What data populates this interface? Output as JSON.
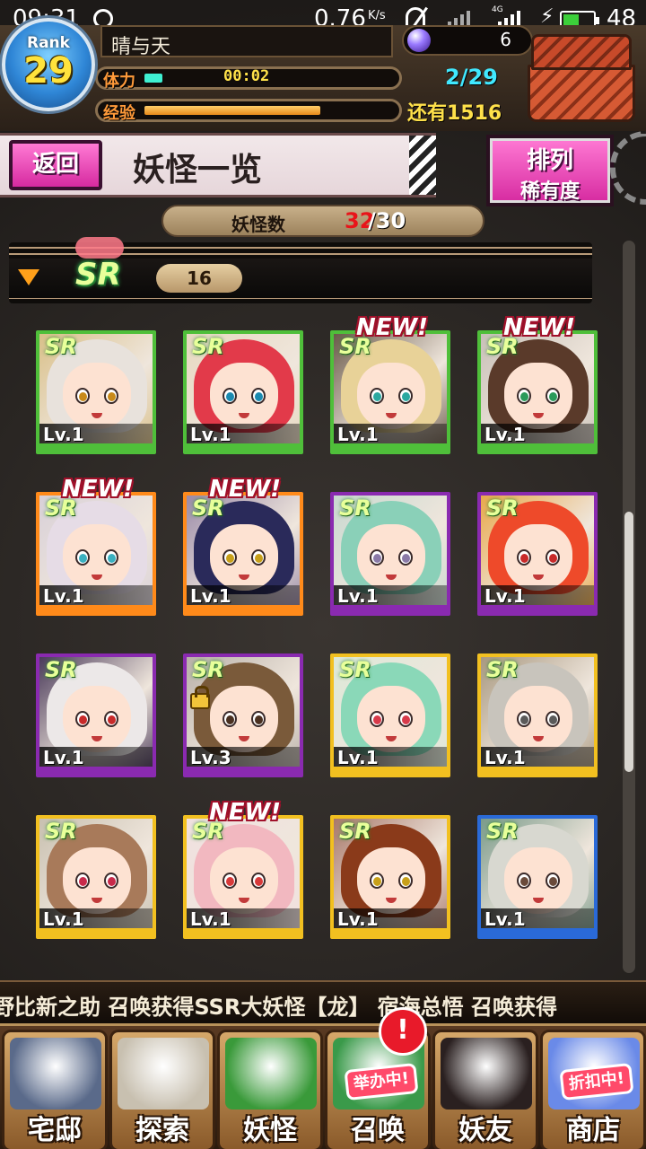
{
  "status_bar": {
    "time": "09:31",
    "net_speed": "0.76",
    "net_unit": "K/s",
    "network": "4G",
    "battery": "48"
  },
  "player": {
    "rank_label": "Rank",
    "rank": "29",
    "name": "晴与天",
    "stamina_label": "体力",
    "stamina_timer": "00:02",
    "stamina_value": "2/29",
    "stamina_fraction": 0.07,
    "exp_label": "经验",
    "exp_remaining": "还有1516",
    "exp_fraction": 0.7,
    "currency": "6"
  },
  "titlebar": {
    "back_label": "返回",
    "title": "妖怪一览",
    "sort_line1": "排列",
    "sort_line2": "稀有度"
  },
  "count": {
    "label": "妖怪数",
    "current": "32",
    "max": "/30"
  },
  "section": {
    "rarity": "SR",
    "count": "16"
  },
  "cards": [
    {
      "rarity": "SR",
      "level": "Lv.1",
      "is_new": false,
      "locked": false,
      "frame": "#4fbf3a",
      "hair": "#e8e2dc",
      "eye": "#c88a1a",
      "bg": "#d9c089"
    },
    {
      "rarity": "SR",
      "level": "Lv.1",
      "is_new": false,
      "locked": false,
      "frame": "#4fbf3a",
      "hair": "#e23a4a",
      "eye": "#1a8ab0",
      "bg": "#e7d8c0"
    },
    {
      "rarity": "SR",
      "level": "Lv.1",
      "is_new": true,
      "locked": false,
      "frame": "#4fbf3a",
      "hair": "#e8d298",
      "eye": "#2aa8a0",
      "bg": "#6a5a4a"
    },
    {
      "rarity": "SR",
      "level": "Lv.1",
      "is_new": true,
      "locked": false,
      "frame": "#4fbf3a",
      "hair": "#5a3a2a",
      "eye": "#2a9a5a",
      "bg": "#c8c0b8"
    },
    {
      "rarity": "SR",
      "level": "Lv.1",
      "is_new": true,
      "locked": false,
      "frame": "#ff8a1a",
      "hair": "#e6dce6",
      "eye": "#3ab0c0",
      "bg": "#d8d0d8"
    },
    {
      "rarity": "SR",
      "level": "Lv.1",
      "is_new": true,
      "locked": false,
      "frame": "#ff8a1a",
      "hair": "#2a2a5a",
      "eye": "#c8a01a",
      "bg": "#9a8aa8"
    },
    {
      "rarity": "SR",
      "level": "Lv.1",
      "is_new": false,
      "locked": false,
      "frame": "#8a2ab0",
      "hair": "#8ad0b8",
      "eye": "#8a7aa8",
      "bg": "#c8d8d0"
    },
    {
      "rarity": "SR",
      "level": "Lv.1",
      "is_new": false,
      "locked": false,
      "frame": "#8a2ab0",
      "hair": "#ee4a2a",
      "eye": "#c82a2a",
      "bg": "#e8a84a"
    },
    {
      "rarity": "SR",
      "level": "Lv.1",
      "is_new": false,
      "locked": false,
      "frame": "#8a2ab0",
      "hair": "#ece8e8",
      "eye": "#c82a2a",
      "bg": "#4a3a5a"
    },
    {
      "rarity": "SR",
      "level": "Lv.3",
      "is_new": false,
      "locked": true,
      "frame": "#8a2ab0",
      "hair": "#7a5a3a",
      "eye": "#4a3020",
      "bg": "#b8b0a8"
    },
    {
      "rarity": "SR",
      "level": "Lv.1",
      "is_new": false,
      "locked": false,
      "frame": "#f2c020",
      "hair": "#8ad8b8",
      "eye": "#d83a4a",
      "bg": "#dce8d8"
    },
    {
      "rarity": "SR",
      "level": "Lv.1",
      "is_new": false,
      "locked": false,
      "frame": "#f2c020",
      "hair": "#c8c4bc",
      "eye": "#5a5a5a",
      "bg": "#a89880"
    },
    {
      "rarity": "SR",
      "level": "Lv.1",
      "is_new": false,
      "locked": false,
      "frame": "#f2c020",
      "hair": "#a87a5a",
      "eye": "#c82a4a",
      "bg": "#c8c0b0"
    },
    {
      "rarity": "SR",
      "level": "Lv.1",
      "is_new": true,
      "locked": false,
      "frame": "#f2c020",
      "hair": "#f2b8c0",
      "eye": "#d83a3a",
      "bg": "#f0e0e0"
    },
    {
      "rarity": "SR",
      "level": "Lv.1",
      "is_new": false,
      "locked": false,
      "frame": "#f2c020",
      "hair": "#8a3a1a",
      "eye": "#c8a01a",
      "bg": "#a8786a"
    },
    {
      "rarity": "SR",
      "level": "Lv.1",
      "is_new": false,
      "locked": false,
      "frame": "#2a6ad8",
      "hair": "#d8d8d0",
      "eye": "#6a4a3a",
      "bg": "#7a9a8a"
    }
  ],
  "ticker": "野比新之助 召唤获得SSR大妖怪【龙】  宿海总悟 召唤获得",
  "nav": [
    {
      "label": "宅邸",
      "icon": "house-icon",
      "color": "#5a6a8a",
      "badge": ""
    },
    {
      "label": "探索",
      "icon": "magnifier-icon",
      "color": "#c8c0b0",
      "badge": ""
    },
    {
      "label": "妖怪",
      "icon": "scroll-icon",
      "color": "#3a9a3a",
      "badge": ""
    },
    {
      "label": "召唤",
      "icon": "summon-icon",
      "color": "#3a9a4a",
      "badge": "举办中!"
    },
    {
      "label": "妖友",
      "icon": "friend-icon",
      "color": "#2a2020",
      "badge": ""
    },
    {
      "label": "商店",
      "icon": "orb-icon",
      "color": "#6a8ae8",
      "badge": "折扣中!"
    }
  ],
  "summon_alert": "!"
}
